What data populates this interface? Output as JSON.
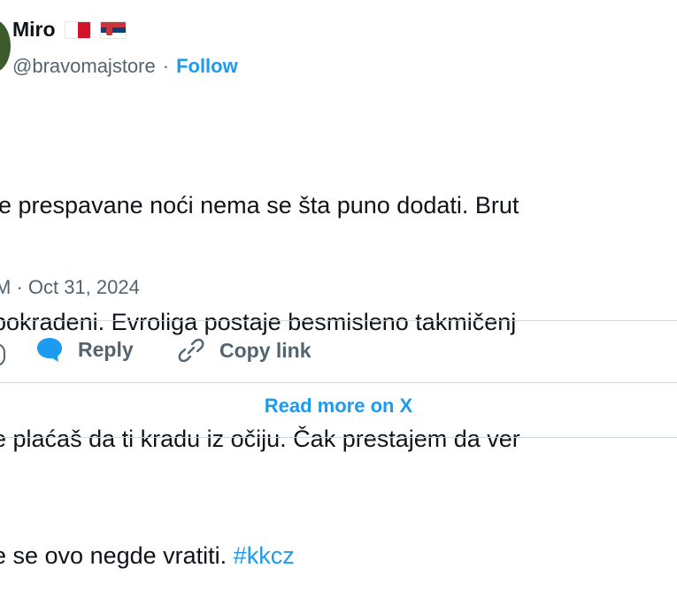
{
  "author": {
    "name": "Miro",
    "handle": "@bravomajstore",
    "separator": "·",
    "follow_label": "Follow",
    "flags": [
      "malta-flag",
      "serbia-flag"
    ]
  },
  "tweet": {
    "lines": [
      "le prespavane noći nema se šta puno dodati. Brut",
      "pokradeni. Evroliga postaje besmisleno takmičenj",
      "e plaćaš da ti kradu iz očiju. Čak prestajem da ver"
    ],
    "last_line_text": "e se ovo negde vratiti. ",
    "hashtag": "#kkcz",
    "timestamp": "M · Oct 31, 2024"
  },
  "actions": {
    "reply_label": "Reply",
    "copy_link_label": "Copy link",
    "read_more_label": "Read more on X"
  },
  "colors": {
    "link": "#1d9bf0",
    "muted": "#536471",
    "text": "#0f1419",
    "divider": "#cfd9de"
  }
}
